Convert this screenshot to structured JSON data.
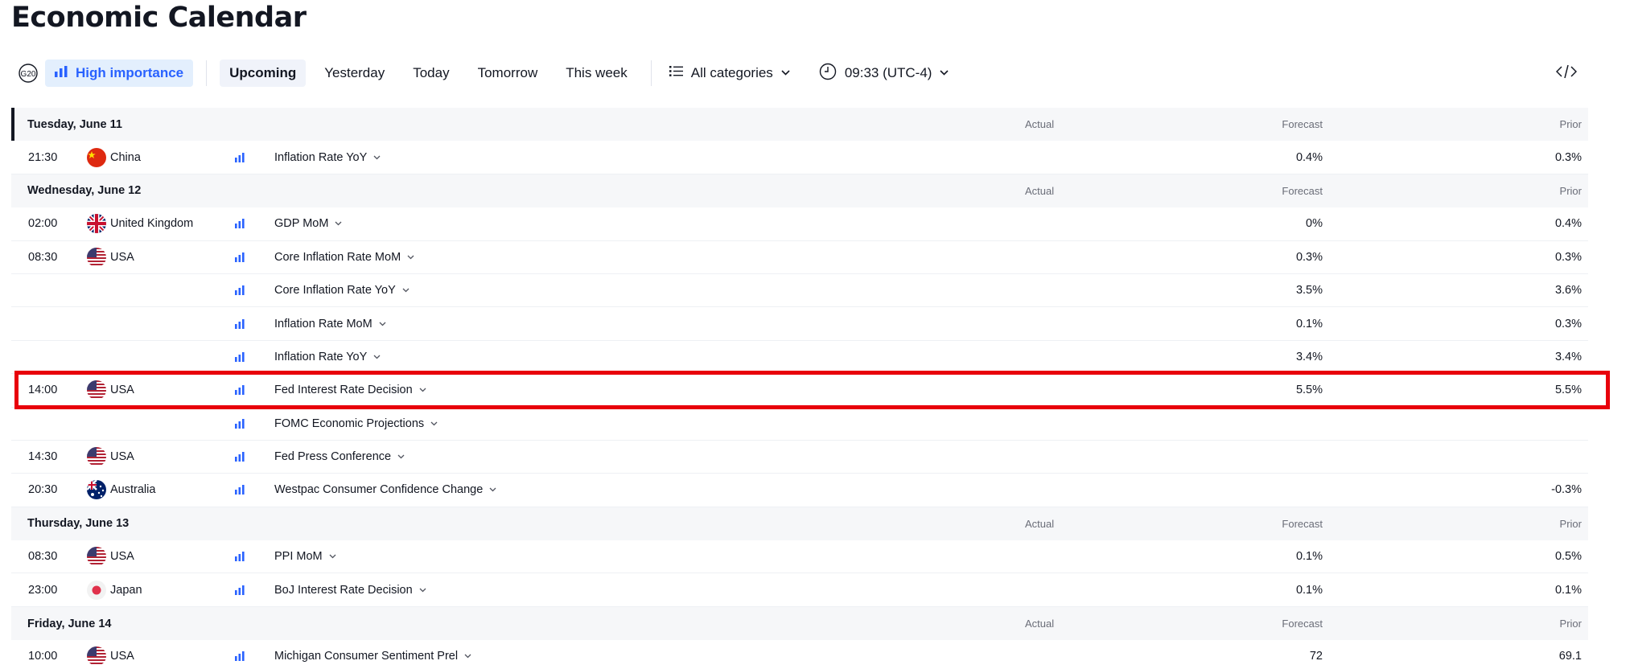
{
  "page": {
    "title": "Economic Calendar"
  },
  "toolbar": {
    "g20_icon": "g20-icon",
    "high_importance": "High importance",
    "tabs": [
      {
        "label": "Upcoming",
        "active": true
      },
      {
        "label": "Yesterday",
        "active": false
      },
      {
        "label": "Today",
        "active": false
      },
      {
        "label": "Tomorrow",
        "active": false
      },
      {
        "label": "This week",
        "active": false
      }
    ],
    "categories": "All categories",
    "timezone": "09:33 (UTC-4)",
    "embed_icon": "code-icon"
  },
  "columns": {
    "actual": "Actual",
    "forecast": "Forecast",
    "prior": "Prior"
  },
  "days": [
    {
      "date": "Tuesday, June 11",
      "events": [
        {
          "time": "21:30",
          "flag": "cn",
          "country": "China",
          "event": "Inflation Rate YoY",
          "actual": "",
          "forecast": "0.4%",
          "prior": "0.3%"
        }
      ]
    },
    {
      "date": "Wednesday, June 12",
      "events": [
        {
          "time": "02:00",
          "flag": "gb",
          "country": "United Kingdom",
          "event": "GDP MoM",
          "actual": "",
          "forecast": "0%",
          "prior": "0.4%"
        },
        {
          "time": "08:30",
          "flag": "us",
          "country": "USA",
          "event": "Core Inflation Rate MoM",
          "actual": "",
          "forecast": "0.3%",
          "prior": "0.3%"
        },
        {
          "time": "",
          "flag": "",
          "country": "",
          "event": "Core Inflation Rate YoY",
          "actual": "",
          "forecast": "3.5%",
          "prior": "3.6%"
        },
        {
          "time": "",
          "flag": "",
          "country": "",
          "event": "Inflation Rate MoM",
          "actual": "",
          "forecast": "0.1%",
          "prior": "0.3%"
        },
        {
          "time": "",
          "flag": "",
          "country": "",
          "event": "Inflation Rate YoY",
          "actual": "",
          "forecast": "3.4%",
          "prior": "3.4%"
        },
        {
          "time": "14:00",
          "flag": "us",
          "country": "USA",
          "event": "Fed Interest Rate Decision",
          "actual": "",
          "forecast": "5.5%",
          "prior": "5.5%",
          "highlighted": true
        },
        {
          "time": "",
          "flag": "",
          "country": "",
          "event": "FOMC Economic Projections",
          "actual": "",
          "forecast": "",
          "prior": ""
        },
        {
          "time": "14:30",
          "flag": "us",
          "country": "USA",
          "event": "Fed Press Conference",
          "actual": "",
          "forecast": "",
          "prior": ""
        },
        {
          "time": "20:30",
          "flag": "au",
          "country": "Australia",
          "event": "Westpac Consumer Confidence Change",
          "actual": "",
          "forecast": "",
          "prior": "-0.3%"
        }
      ]
    },
    {
      "date": "Thursday, June 13",
      "events": [
        {
          "time": "08:30",
          "flag": "us",
          "country": "USA",
          "event": "PPI MoM",
          "actual": "",
          "forecast": "0.1%",
          "prior": "0.5%"
        },
        {
          "time": "23:00",
          "flag": "jp",
          "country": "Japan",
          "event": "BoJ Interest Rate Decision",
          "actual": "",
          "forecast": "0.1%",
          "prior": "0.1%"
        }
      ]
    },
    {
      "date": "Friday, June 14",
      "events": [
        {
          "time": "10:00",
          "flag": "us",
          "country": "USA",
          "event": "Michigan Consumer Sentiment Prel",
          "actual": "",
          "forecast": "72",
          "prior": "69.1"
        }
      ]
    }
  ],
  "colors": {
    "accent": "#2962ff",
    "highlight_border": "#e8000b",
    "header_bg": "#f6f7f9"
  }
}
